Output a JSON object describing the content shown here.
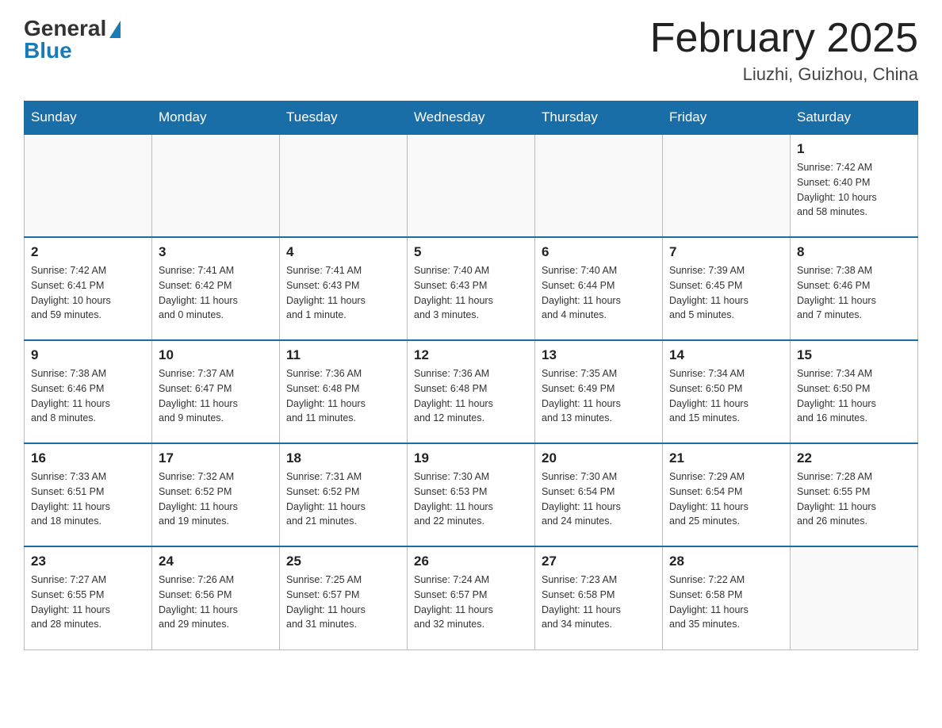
{
  "header": {
    "logo_general": "General",
    "logo_blue": "Blue",
    "title": "February 2025",
    "subtitle": "Liuzhi, Guizhou, China"
  },
  "days_of_week": [
    "Sunday",
    "Monday",
    "Tuesday",
    "Wednesday",
    "Thursday",
    "Friday",
    "Saturday"
  ],
  "weeks": [
    [
      {
        "day": "",
        "info": ""
      },
      {
        "day": "",
        "info": ""
      },
      {
        "day": "",
        "info": ""
      },
      {
        "day": "",
        "info": ""
      },
      {
        "day": "",
        "info": ""
      },
      {
        "day": "",
        "info": ""
      },
      {
        "day": "1",
        "info": "Sunrise: 7:42 AM\nSunset: 6:40 PM\nDaylight: 10 hours\nand 58 minutes."
      }
    ],
    [
      {
        "day": "2",
        "info": "Sunrise: 7:42 AM\nSunset: 6:41 PM\nDaylight: 10 hours\nand 59 minutes."
      },
      {
        "day": "3",
        "info": "Sunrise: 7:41 AM\nSunset: 6:42 PM\nDaylight: 11 hours\nand 0 minutes."
      },
      {
        "day": "4",
        "info": "Sunrise: 7:41 AM\nSunset: 6:43 PM\nDaylight: 11 hours\nand 1 minute."
      },
      {
        "day": "5",
        "info": "Sunrise: 7:40 AM\nSunset: 6:43 PM\nDaylight: 11 hours\nand 3 minutes."
      },
      {
        "day": "6",
        "info": "Sunrise: 7:40 AM\nSunset: 6:44 PM\nDaylight: 11 hours\nand 4 minutes."
      },
      {
        "day": "7",
        "info": "Sunrise: 7:39 AM\nSunset: 6:45 PM\nDaylight: 11 hours\nand 5 minutes."
      },
      {
        "day": "8",
        "info": "Sunrise: 7:38 AM\nSunset: 6:46 PM\nDaylight: 11 hours\nand 7 minutes."
      }
    ],
    [
      {
        "day": "9",
        "info": "Sunrise: 7:38 AM\nSunset: 6:46 PM\nDaylight: 11 hours\nand 8 minutes."
      },
      {
        "day": "10",
        "info": "Sunrise: 7:37 AM\nSunset: 6:47 PM\nDaylight: 11 hours\nand 9 minutes."
      },
      {
        "day": "11",
        "info": "Sunrise: 7:36 AM\nSunset: 6:48 PM\nDaylight: 11 hours\nand 11 minutes."
      },
      {
        "day": "12",
        "info": "Sunrise: 7:36 AM\nSunset: 6:48 PM\nDaylight: 11 hours\nand 12 minutes."
      },
      {
        "day": "13",
        "info": "Sunrise: 7:35 AM\nSunset: 6:49 PM\nDaylight: 11 hours\nand 13 minutes."
      },
      {
        "day": "14",
        "info": "Sunrise: 7:34 AM\nSunset: 6:50 PM\nDaylight: 11 hours\nand 15 minutes."
      },
      {
        "day": "15",
        "info": "Sunrise: 7:34 AM\nSunset: 6:50 PM\nDaylight: 11 hours\nand 16 minutes."
      }
    ],
    [
      {
        "day": "16",
        "info": "Sunrise: 7:33 AM\nSunset: 6:51 PM\nDaylight: 11 hours\nand 18 minutes."
      },
      {
        "day": "17",
        "info": "Sunrise: 7:32 AM\nSunset: 6:52 PM\nDaylight: 11 hours\nand 19 minutes."
      },
      {
        "day": "18",
        "info": "Sunrise: 7:31 AM\nSunset: 6:52 PM\nDaylight: 11 hours\nand 21 minutes."
      },
      {
        "day": "19",
        "info": "Sunrise: 7:30 AM\nSunset: 6:53 PM\nDaylight: 11 hours\nand 22 minutes."
      },
      {
        "day": "20",
        "info": "Sunrise: 7:30 AM\nSunset: 6:54 PM\nDaylight: 11 hours\nand 24 minutes."
      },
      {
        "day": "21",
        "info": "Sunrise: 7:29 AM\nSunset: 6:54 PM\nDaylight: 11 hours\nand 25 minutes."
      },
      {
        "day": "22",
        "info": "Sunrise: 7:28 AM\nSunset: 6:55 PM\nDaylight: 11 hours\nand 26 minutes."
      }
    ],
    [
      {
        "day": "23",
        "info": "Sunrise: 7:27 AM\nSunset: 6:55 PM\nDaylight: 11 hours\nand 28 minutes."
      },
      {
        "day": "24",
        "info": "Sunrise: 7:26 AM\nSunset: 6:56 PM\nDaylight: 11 hours\nand 29 minutes."
      },
      {
        "day": "25",
        "info": "Sunrise: 7:25 AM\nSunset: 6:57 PM\nDaylight: 11 hours\nand 31 minutes."
      },
      {
        "day": "26",
        "info": "Sunrise: 7:24 AM\nSunset: 6:57 PM\nDaylight: 11 hours\nand 32 minutes."
      },
      {
        "day": "27",
        "info": "Sunrise: 7:23 AM\nSunset: 6:58 PM\nDaylight: 11 hours\nand 34 minutes."
      },
      {
        "day": "28",
        "info": "Sunrise: 7:22 AM\nSunset: 6:58 PM\nDaylight: 11 hours\nand 35 minutes."
      },
      {
        "day": "",
        "info": ""
      }
    ]
  ]
}
